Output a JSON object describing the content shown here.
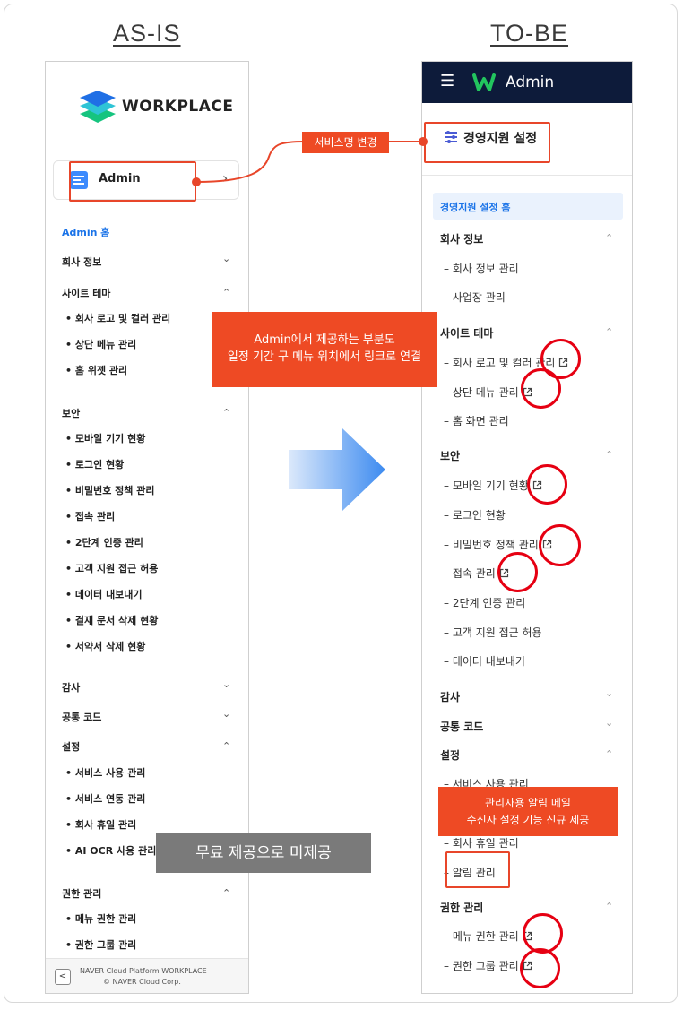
{
  "headings": {
    "as_is": "AS-IS",
    "to_be": "TO-BE"
  },
  "left": {
    "logo_text": "WORKPLACE",
    "admin_label": "Admin",
    "admin_arrow": "›",
    "home": "Admin 홈",
    "company": "회사 정보",
    "site_theme": {
      "title": "사이트 테마",
      "items": [
        "회사 로고 및 컬러 관리",
        "상단 메뉴 관리",
        "홈 위젯 관리"
      ]
    },
    "security": {
      "title": "보안",
      "items": [
        "모바일 기기 현황",
        "로그인 현황",
        "비밀번호 정책 관리",
        "접속 관리",
        "2단계 인증 관리",
        "고객 지원 접근 허용",
        "데이터 내보내기",
        "결재 문서 삭제 현황",
        "서약서 삭제 현황"
      ]
    },
    "audit": "감사",
    "common_code": "공통 코드",
    "settings": {
      "title": "설정",
      "items": [
        "서비스 사용 관리",
        "서비스 연동 관리",
        "회사 휴일 관리",
        "AI OCR 사용 관리"
      ]
    },
    "permissions": {
      "title": "권한 관리",
      "items": [
        "메뉴 권한 관리",
        "권한 그룹 관리"
      ]
    },
    "footer": {
      "line1": "NAVER Cloud Platform WORKPLACE",
      "line2": "© NAVER Cloud Corp.",
      "collapse": "<"
    }
  },
  "right": {
    "topbar_title": "Admin",
    "page_title": "경영지원 설정",
    "home": "경영지원 설정 홈",
    "company": {
      "title": "회사 정보",
      "items": [
        "회사 정보 관리",
        "사업장 관리"
      ]
    },
    "site_theme": {
      "title": "사이트 테마",
      "items": [
        "회사 로고 및 컬러 관리",
        "상단 메뉴 관리",
        "홈 화면 관리"
      ]
    },
    "security": {
      "title": "보안",
      "items": [
        "모바일 기기 현황",
        "로그인 현황",
        "비밀번호 정책 관리",
        "접속 관리",
        "2단계 인증 관리",
        "고객 지원 접근 허용",
        "데이터 내보내기"
      ]
    },
    "audit": "감사",
    "common_code": "공통 코드",
    "settings": {
      "title": "설정",
      "items": [
        "서비스 사용 관리",
        "회사 휴일 관리",
        "알림 관리"
      ]
    },
    "permissions": {
      "title": "권한 관리",
      "items": [
        "메뉴 권한 관리",
        "권한 그룹 관리"
      ]
    }
  },
  "annotations": {
    "service_rename": "서비스명 변경",
    "admin_link_line1": "Admin에서 제공하는 부분도",
    "admin_link_line2": "일정 기간 구 메뉴 위치에서 링크로 연결",
    "alert_line1": "관리자용 알림 메일",
    "alert_line2": "수신자 설정 기능 신규 제공",
    "free_not_provided": "무료 제공으로 미제공"
  },
  "colors": {
    "accent": "#ee4a24",
    "topbar": "#0d1b3a",
    "link": "#1a73e8",
    "circle": "#e60012"
  }
}
